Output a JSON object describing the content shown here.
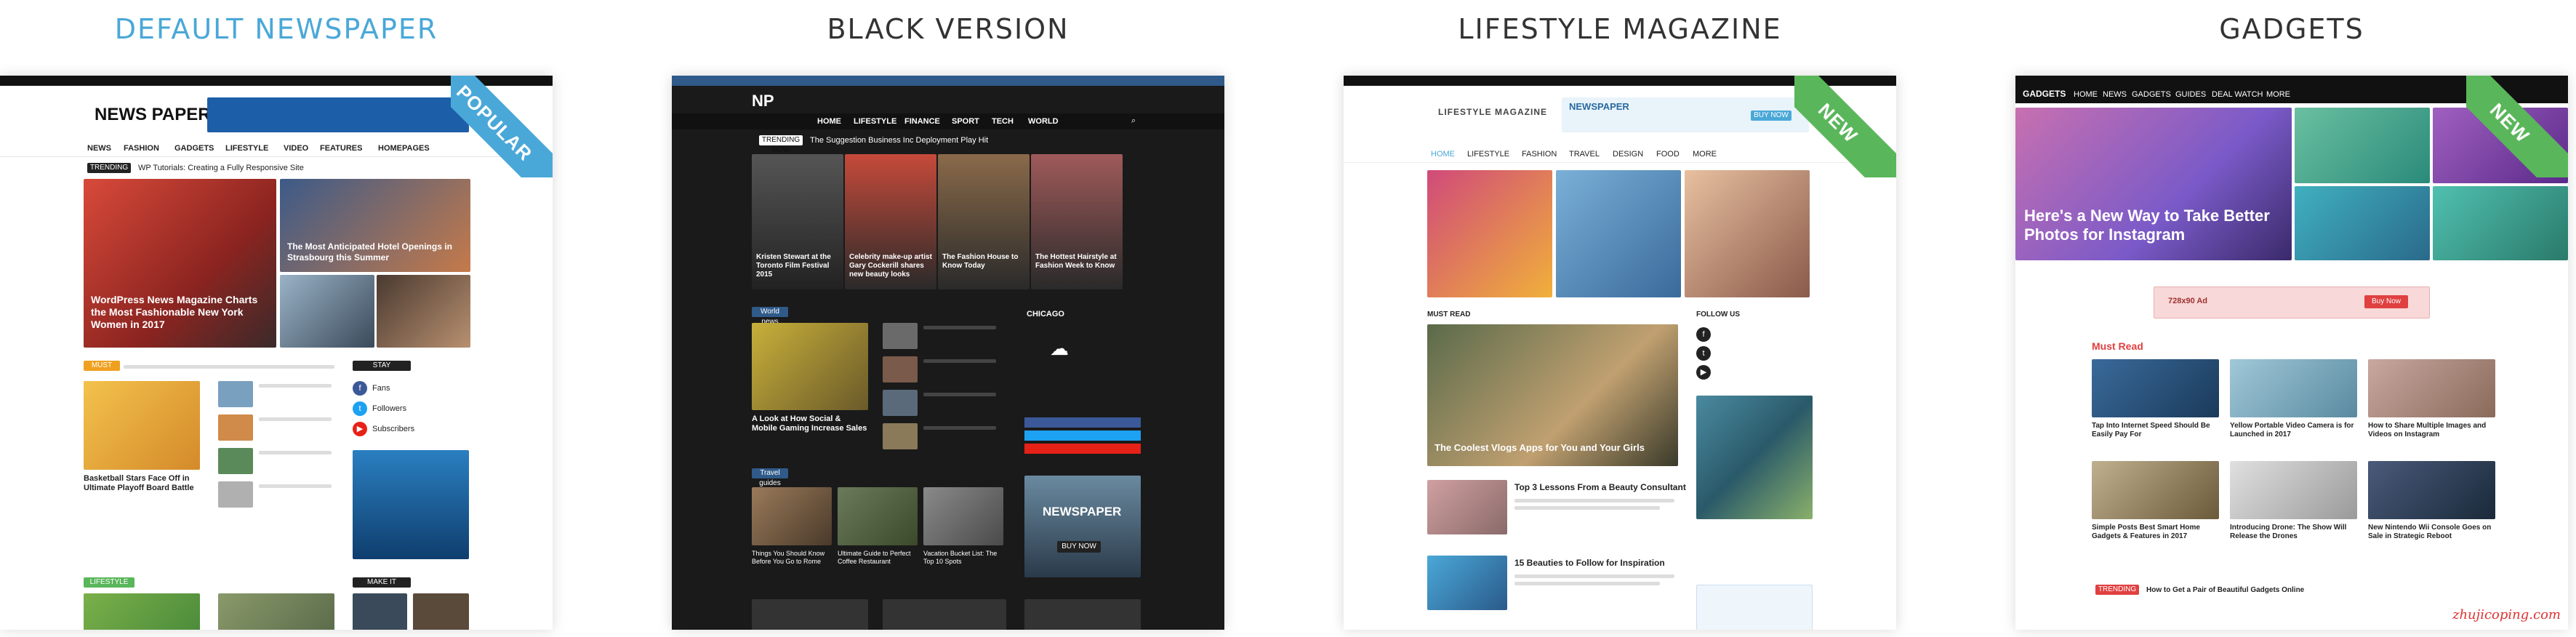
{
  "demos": [
    {
      "title": "DEFAULT NEWSPAPER",
      "ribbon": "POPULAR",
      "ribbon_color": "#4aa8d8",
      "logo": "NEWS PAPER",
      "nav": [
        "NEWS",
        "FASHION",
        "GADGETS",
        "LIFESTYLE",
        "VIDEO",
        "FEATURES",
        "HOMEPAGES"
      ],
      "ticker_label": "TRENDING NOW",
      "ticker_text": "WP Tutorials: Creating a Fully Responsive Site",
      "headline_main": "WordPress News Magazine Charts the Most Fashionable New York Women in 2017",
      "headline_right": "The Most Anticipated Hotel Openings in Strasbourg this Summer",
      "section_1": "MUST READ",
      "section_2": "STAY CONNECTED",
      "article_1": "Basketball Stars Face Off in Ultimate Playoff Board Battle",
      "section_3": "LIFESTYLE NEWS",
      "section_4": "MAKE IT MODERN",
      "social": [
        "Fans",
        "Followers",
        "Subscribers"
      ]
    },
    {
      "title": "BLACK VERSION",
      "logo": "NP",
      "nav": [
        "HOME",
        "LIFESTYLE",
        "FINANCE",
        "SPORT",
        "TECH",
        "WORLD"
      ],
      "ticker_label": "TRENDING NOW",
      "ticker_text": "The Suggestion Business Inc Deployment Play Hit",
      "cards": [
        "Kristen Stewart at the Toronto Film Festival 2015",
        "Celebrity make-up artist Gary Cockerill shares new beauty looks",
        "The Fashion House to Know Today",
        "The Hottest Hairstyle at Fashion Week to Know"
      ],
      "section_1": "World news",
      "article_1": "A Look at How Social & Mobile Gaming Increase Sales",
      "weather_city": "CHICAGO",
      "section_2": "Travel guides",
      "travel": [
        "Things You Should Know Before You Go to Rome",
        "Ultimate Guide to Perfect Coffee Restaurant",
        "Vacation Bucket List: The Top 10 Spots"
      ],
      "promo": "NEWSPAPER",
      "promo_button": "BUY NOW"
    },
    {
      "title": "LIFESTYLE MAGAZINE",
      "ribbon": "NEW",
      "ribbon_color": "#5ab65a",
      "logo": "LIFESTYLE MAGAZINE",
      "banner": "NEWSPAPER",
      "banner_button": "BUY NOW",
      "nav": [
        "HOME",
        "LIFESTYLE",
        "FASHION",
        "TRAVEL",
        "DESIGN",
        "FOOD",
        "MORE"
      ],
      "section_1": "MUST READ",
      "section_2": "FOLLOW US",
      "feature": "The Coolest Vlogs Apps for You and Your Girls",
      "posts": [
        "Top 3 Lessons From a Beauty Consultant",
        "15 Beauties to Follow for Inspiration"
      ]
    },
    {
      "title": "GADGETS",
      "ribbon": "NEW",
      "ribbon_color": "#5ab65a",
      "logo": "GADGETS",
      "nav": [
        "HOME",
        "NEWS",
        "GADGETS",
        "GUIDES",
        "DEAL WATCH",
        "MORE"
      ],
      "hero": "Here's a New Way to Take Better Photos for Instagram",
      "ad_text": "728x90 Ad",
      "ad_button": "Buy Now",
      "section_1": "Must Read",
      "grid": [
        "Tap Into Internet Speed Should Be Easily Pay For",
        "Yellow Portable Video Camera is for Launched in 2017",
        "How to Share Multiple Images and Videos on Instagram",
        "Simple Posts Best Smart Home Gadgets & Features in 2017",
        "Introducing Drone: The Show Will Release the Drones",
        "New Nintendo Wii Console Goes on Sale in Strategic Reboot"
      ],
      "ticker_label": "TRENDING NOW",
      "ticker_text": "How to Get a Pair of Beautiful Gadgets Online"
    }
  ],
  "watermark": "zhujicoping.com"
}
